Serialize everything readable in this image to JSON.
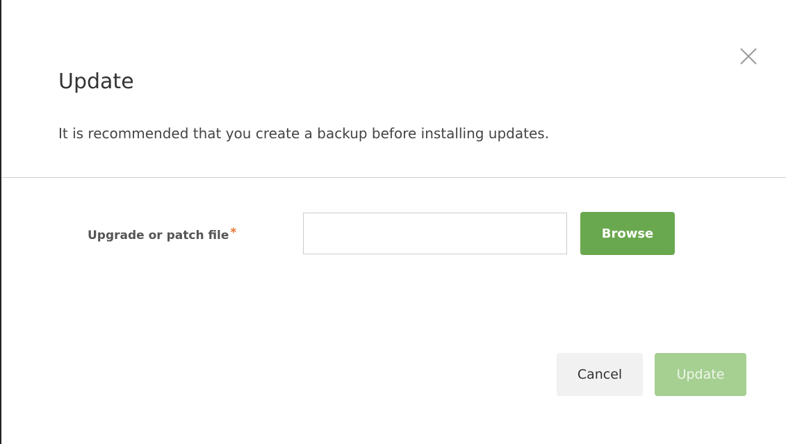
{
  "dialog": {
    "title": "Update",
    "subtitle": "It is recommended that you create a backup before installing updates.",
    "close_icon": "close-icon"
  },
  "form": {
    "file_label": "Upgrade or patch file",
    "required_marker": "*",
    "file_value": "",
    "file_placeholder": "",
    "browse_label": "Browse"
  },
  "footer": {
    "cancel_label": "Cancel",
    "update_label": "Update",
    "update_disabled": true
  },
  "colors": {
    "primary_green": "#6aa84f",
    "disabled_green": "#a6cf92",
    "required_orange": "#e87430"
  }
}
